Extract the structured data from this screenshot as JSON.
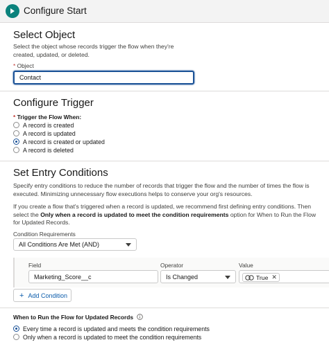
{
  "header": {
    "title": "Configure Start",
    "icon": "play-icon",
    "icon_color": "#0b827c"
  },
  "select_object": {
    "title": "Select Object",
    "help": "Select the object whose records trigger the flow when they're created, updated, or deleted.",
    "object_label": "Object",
    "required_mark": "*",
    "object_value": "Contact"
  },
  "configure_trigger": {
    "title": "Configure Trigger",
    "required_mark": "*",
    "label": "Trigger the Flow When:",
    "options": [
      {
        "label": "A record is created",
        "checked": false
      },
      {
        "label": "A record is updated",
        "checked": false
      },
      {
        "label": "A record is created or updated",
        "checked": true
      },
      {
        "label": "A record is deleted",
        "checked": false
      }
    ]
  },
  "entry_conditions": {
    "title": "Set Entry Conditions",
    "help1": "Specify entry conditions to reduce the number of records that trigger the flow and the number of times the flow is executed. Minimizing unnecessary flow executions helps to conserve your org's resources.",
    "help2_prefix": "If you create a flow that's triggered when a record is updated, we recommend first defining entry conditions. Then select the",
    "help2_bold": "Only when a record is updated to meet the condition requirements",
    "help2_suffix": "option for When to Run the Flow for Updated Records.",
    "condition_requirements_label": "Condition Requirements",
    "condition_requirements_value": "All Conditions Are Met (AND)",
    "condition": {
      "field_label": "Field",
      "field_value": "Marketing_Score__c",
      "operator_label": "Operator",
      "operator_value": "Is Changed",
      "value_label": "Value",
      "value_pill": "True"
    },
    "add_condition_label": "Add Condition"
  },
  "when_to_run": {
    "label": "When to Run the Flow for Updated Records",
    "options": [
      {
        "label": "Every time a record is updated and meets the condition requirements",
        "checked": true
      },
      {
        "label": "Only when a record is updated to meet the condition requirements",
        "checked": false
      }
    ]
  },
  "colors": {
    "accent": "#1b5297",
    "link": "#0b5cab",
    "required": "#c23934"
  }
}
